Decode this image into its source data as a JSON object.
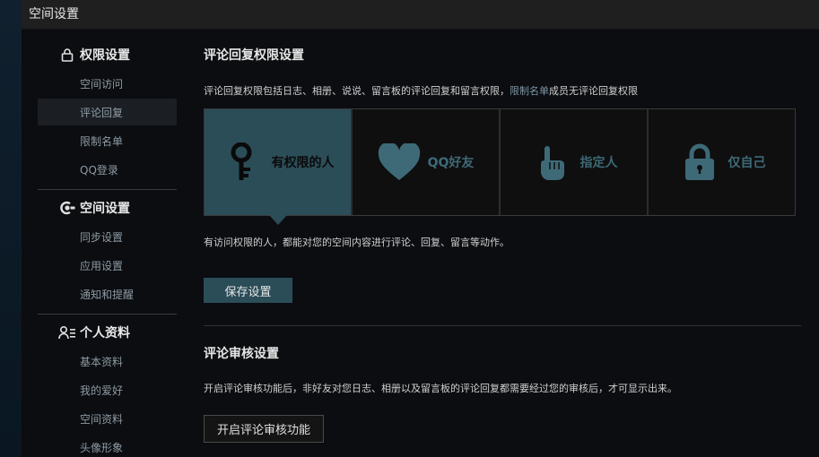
{
  "window": {
    "title": "空间设置"
  },
  "sidebar": {
    "groups": [
      {
        "label": "权限设置",
        "icon": "lock-icon",
        "items": [
          "空间访问",
          "评论回复",
          "限制名单",
          "QQ登录"
        ]
      },
      {
        "label": "空间设置",
        "icon": "space-settings-icon",
        "items": [
          "同步设置",
          "应用设置",
          "通知和提醒"
        ]
      },
      {
        "label": "个人资料",
        "icon": "profile-icon",
        "items": [
          "基本资料",
          "我的爱好",
          "空间资料",
          "头像形象"
        ]
      }
    ],
    "active_item": "评论回复"
  },
  "comment_permission": {
    "title": "评论回复权限设置",
    "desc_prefix": "评论回复权限包括日志、相册、说说、留言板的评论回复和留言权限，",
    "desc_link": "限制名单",
    "desc_suffix": "成员无评论回复权限",
    "options": [
      {
        "label": "有权限的人",
        "icon": "key-icon",
        "selected": true
      },
      {
        "label": "QQ好友",
        "icon": "heart-icon",
        "selected": false
      },
      {
        "label": "指定人",
        "icon": "pointing-hand-icon",
        "selected": false
      },
      {
        "label": "仅自己",
        "icon": "padlock-icon",
        "selected": false
      }
    ],
    "selected_desc": "有访问权限的人，都能对您的空间内容进行评论、回复、留言等动作。",
    "save_label": "保存设置"
  },
  "comment_review": {
    "title": "评论审核设置",
    "desc": "开启评论审核功能后，非好友对您日志、相册以及留言板的评论回复都需要经过您的审核后，才可显示出来。",
    "button_label": "开启评论审核功能"
  },
  "colors": {
    "accent": "#2b4d58",
    "icon": "#3e6a78",
    "background": "#0b0d10"
  }
}
